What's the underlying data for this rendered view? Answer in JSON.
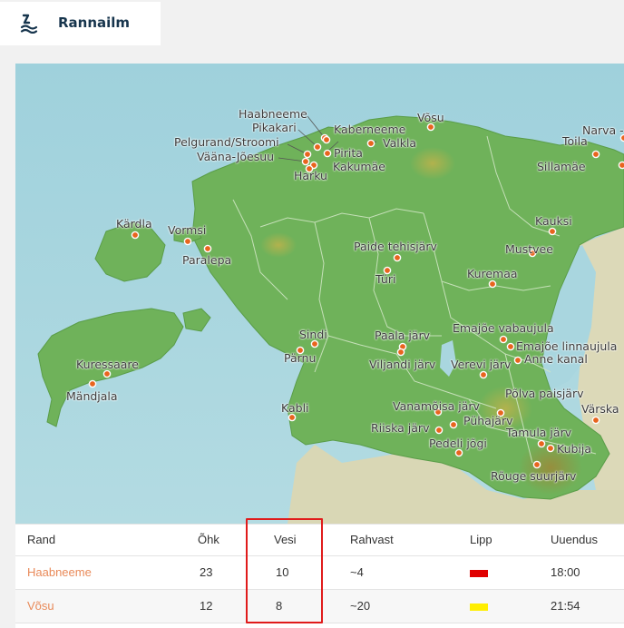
{
  "app": {
    "title": "Rannailm",
    "logo_icon": "wave-logo-icon"
  },
  "map": {
    "land_color": "#6fb25a",
    "sea_color": "#a9d6df",
    "marker_color": "#e8641e",
    "places": [
      {
        "name": "Haabneeme"
      },
      {
        "name": "Pikakari"
      },
      {
        "name": "Pelgurand/Stroomi"
      },
      {
        "name": "Vääna-Jõesuu"
      },
      {
        "name": "Kaberneeme"
      },
      {
        "name": "Valkla"
      },
      {
        "name": "Pirita"
      },
      {
        "name": "Kakumäe"
      },
      {
        "name": "Harku"
      },
      {
        "name": "Võsu"
      },
      {
        "name": "Narva - Jõesuu"
      },
      {
        "name": "Toila"
      },
      {
        "name": "Sillamäe"
      },
      {
        "name": "Kärdla"
      },
      {
        "name": "Vormsi"
      },
      {
        "name": "Paralepa"
      },
      {
        "name": "Kauksi"
      },
      {
        "name": "Paide tehisjärv"
      },
      {
        "name": "Mustvee"
      },
      {
        "name": "Türi"
      },
      {
        "name": "Kuremaa"
      },
      {
        "name": "Emajõe vabaujula"
      },
      {
        "name": "Sindi"
      },
      {
        "name": "Paala järv"
      },
      {
        "name": "Emajõe linnaujula"
      },
      {
        "name": "Pärnu"
      },
      {
        "name": "Kuressaare"
      },
      {
        "name": "Viljandi järv"
      },
      {
        "name": "Verevi järv"
      },
      {
        "name": "Anne kanal"
      },
      {
        "name": "Mändjala"
      },
      {
        "name": "Põlva paisjärv"
      },
      {
        "name": "Vanamõisa järv"
      },
      {
        "name": "Kabli"
      },
      {
        "name": "Värska"
      },
      {
        "name": "Pühajärv"
      },
      {
        "name": "Riiska järv"
      },
      {
        "name": "Tamula järv"
      },
      {
        "name": "Pedeli jõgi"
      },
      {
        "name": "Kubija"
      },
      {
        "name": "Rõuge suurjärv"
      }
    ]
  },
  "table": {
    "headers": {
      "beach": "Rand",
      "air": "Õhk",
      "water": "Vesi",
      "crowd": "Rahvast",
      "flag": "Lipp",
      "updated": "Uuendus"
    },
    "rows": [
      {
        "beach": "Haabneeme",
        "air": "23",
        "water": "10",
        "crowd": "~4",
        "flag_color": "#e00000",
        "updated": "18:00"
      },
      {
        "beach": "Võsu",
        "air": "12",
        "water": "8",
        "crowd": "~20",
        "flag_color": "#ffee00",
        "updated": "21:54"
      }
    ]
  }
}
